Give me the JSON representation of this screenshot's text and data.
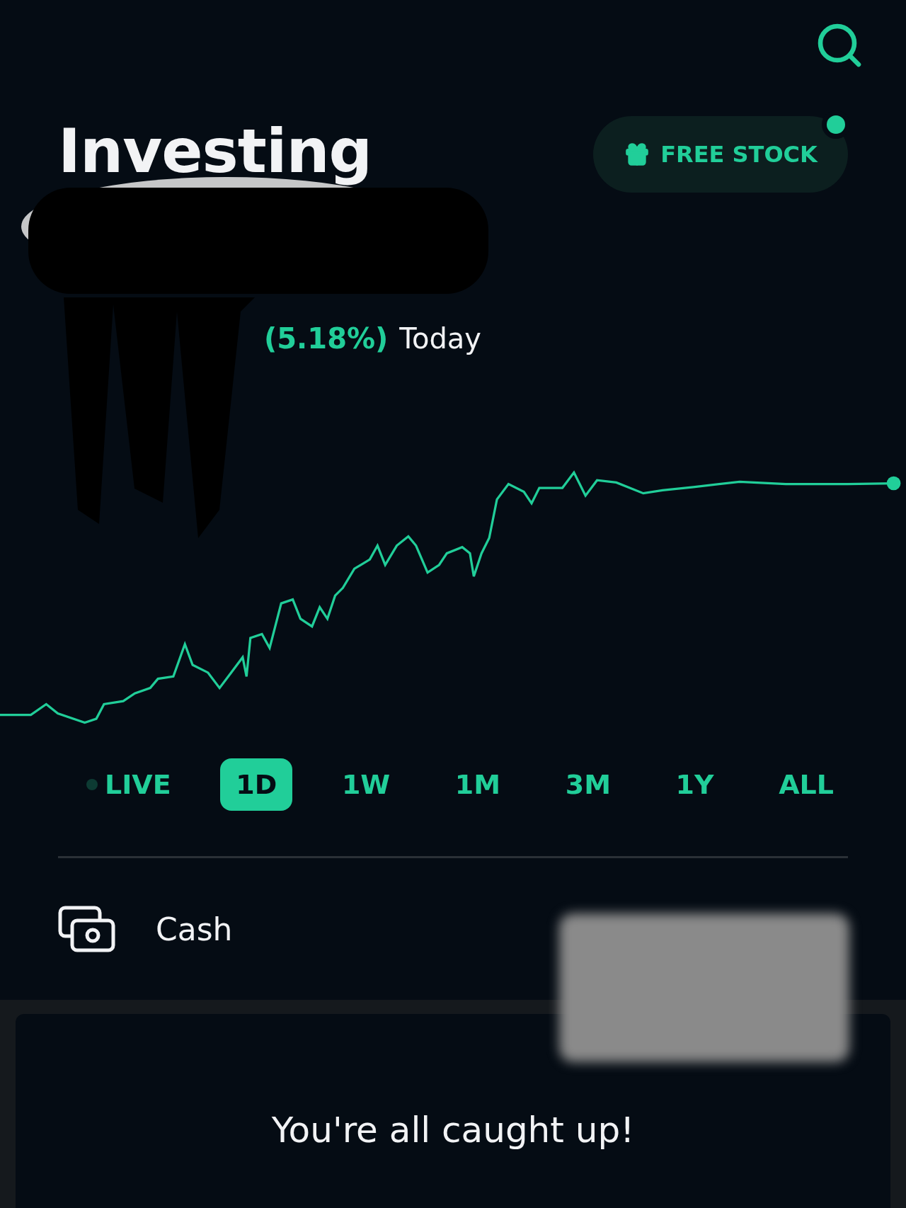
{
  "header": {
    "title": "Investing",
    "promo": {
      "label": "FREE STOCK",
      "notification": true
    }
  },
  "today_change": {
    "percent": "(5.18%)",
    "period": "Today"
  },
  "periods": [
    {
      "label": "LIVE",
      "kind": "live",
      "selected": false
    },
    {
      "label": "1D",
      "kind": "range",
      "selected": true
    },
    {
      "label": "1W",
      "kind": "range",
      "selected": false
    },
    {
      "label": "1M",
      "kind": "range",
      "selected": false
    },
    {
      "label": "3M",
      "kind": "range",
      "selected": false
    },
    {
      "label": "1Y",
      "kind": "range",
      "selected": false
    },
    {
      "label": "ALL",
      "kind": "range",
      "selected": false
    }
  ],
  "cash": {
    "label": "Cash"
  },
  "feed": {
    "message": "You're all caught up!"
  }
}
